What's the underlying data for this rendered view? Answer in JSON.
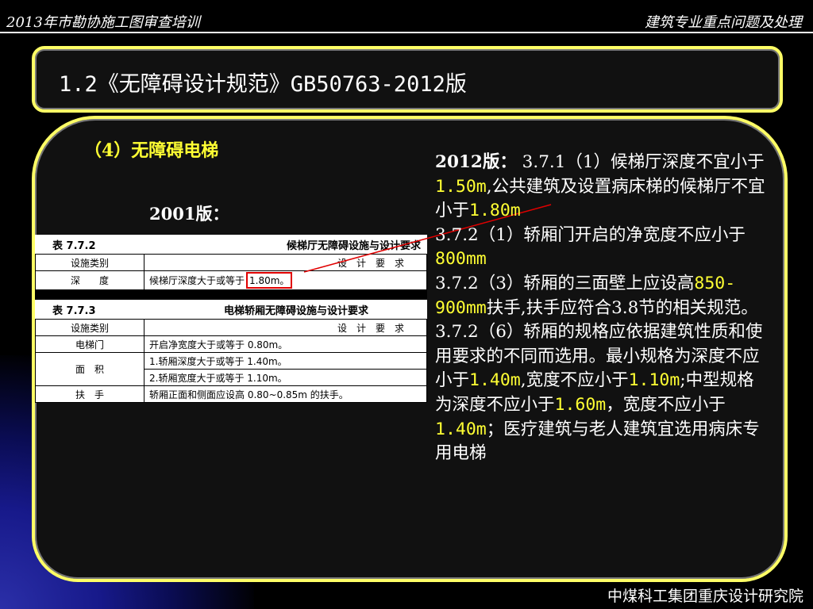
{
  "header": {
    "left": "2013年市勘协施工图审查培训",
    "right": "建筑专业重点问题及处理"
  },
  "title": "1.2《无障碍设计规范》GB50763-2012版",
  "subtitle": "（4）无障碍电梯",
  "label_2001": "2001版：",
  "table_772": {
    "num": "表 7.7.2",
    "name": "候梯厅无障碍设施与设计要求",
    "head_col1": "设施类别",
    "head_col2": "设　计　要　求",
    "row1_col1": "深　　度",
    "row1_text": "候梯厅深度大于或等于",
    "row1_value": "1.80m。"
  },
  "table_773": {
    "num": "表 7.7.3",
    "name": "电梯轿厢无障碍设施与设计要求",
    "head_col1": "设施类别",
    "head_col2": "设　计　要　求",
    "rows": [
      {
        "col1": "电梯门",
        "col2": "开启净宽度大于或等于 0.80m。"
      },
      {
        "col1": "面　积",
        "col2": "1.轿厢深度大于或等于 1.40m。"
      },
      {
        "col2": "2.轿厢宽度大于或等于 1.10m。"
      },
      {
        "col1": "扶　手",
        "col2": "轿厢正面和侧面应设高 0.80~0.85m 的扶手。"
      }
    ]
  },
  "right": {
    "lead": "2012版：",
    "p1a": " 3.7.1（1）候梯厅深度不宜小于",
    "v1": "1.50m",
    "p1b": ",公共建筑及设置病床梯的候梯厅不宜小于",
    "v2": "1.80m",
    "p2a": "3.7.2（1）轿厢门开启的净宽度不应小于",
    "v3": "800mm",
    "p3a": "3.7.2（3）轿厢的三面壁上应设高",
    "v4": "850-900mm",
    "p3b": "扶手,扶手应符合3.8节的相关规范。",
    "p4a": "3.7.2（6）轿厢的规格应依据建筑性质和使用要求的不同而选用。最小规格为深度不应小于",
    "v5": "1.40m",
    "p4b": ",宽度不应小于",
    "v6": "1.10m",
    "p4c": ";中型规格为深度不应小于",
    "v7": "1.60m",
    "p4d": "，宽度不应小于",
    "v8": "1.40m",
    "p4e": "；医疗建筑与老人建筑宜选用病床专用电梯"
  },
  "footer": "中煤科工集团重庆设计研究院",
  "colors": {
    "frame": "#ffff66",
    "accent_text": "#ffff33",
    "highlight_box": "#e00000",
    "background": "#000000",
    "corner_glow": "#17198a"
  }
}
